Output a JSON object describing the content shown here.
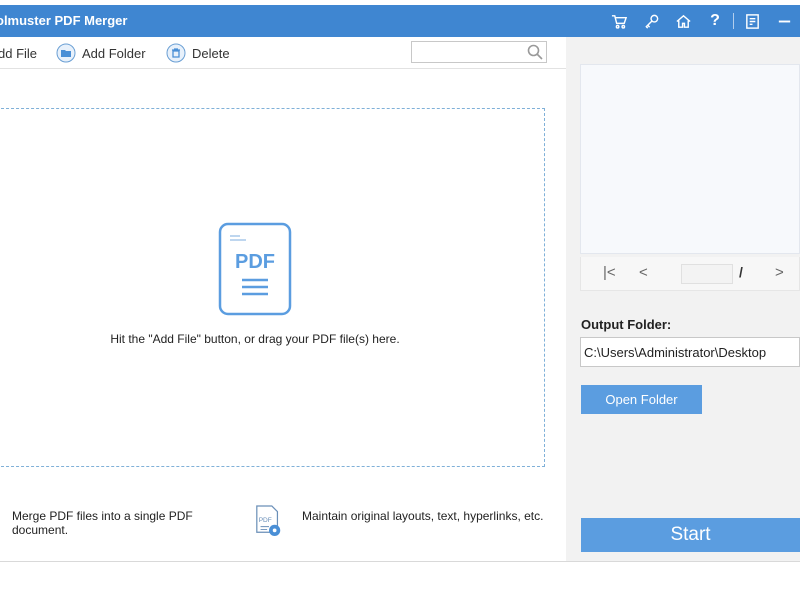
{
  "window": {
    "title": "olmuster PDF Merger",
    "accent_color": "#3f86d1",
    "title_icons": [
      "cart-icon",
      "key-icon",
      "home-icon",
      "help-icon",
      "feedback-icon",
      "minimize-icon"
    ],
    "help_glyph": "?"
  },
  "toolbar": {
    "add_file_label": "dd File",
    "add_folder_label": "Add Folder",
    "delete_label": "Delete",
    "search_value": "",
    "search_placeholder": ""
  },
  "dropzone": {
    "icon_text": "PDF",
    "hint": "Hit the \"Add File\" button, or drag your PDF file(s) here."
  },
  "features": {
    "item1": "Merge PDF files into a single PDF document.",
    "item2": "Maintain original layouts, text, hyperlinks, etc.",
    "item2_icon_text": "PDF"
  },
  "preview": {
    "first_glyph": "|<",
    "prev_glyph": "<",
    "page_value": "",
    "slash": "/",
    "next_glyph": ">"
  },
  "output": {
    "label": "Output Folder:",
    "path": "C:\\Users\\Administrator\\Desktop",
    "open_button_label": "Open Folder",
    "start_button_label": "Start",
    "button_color": "#5b9de0"
  }
}
